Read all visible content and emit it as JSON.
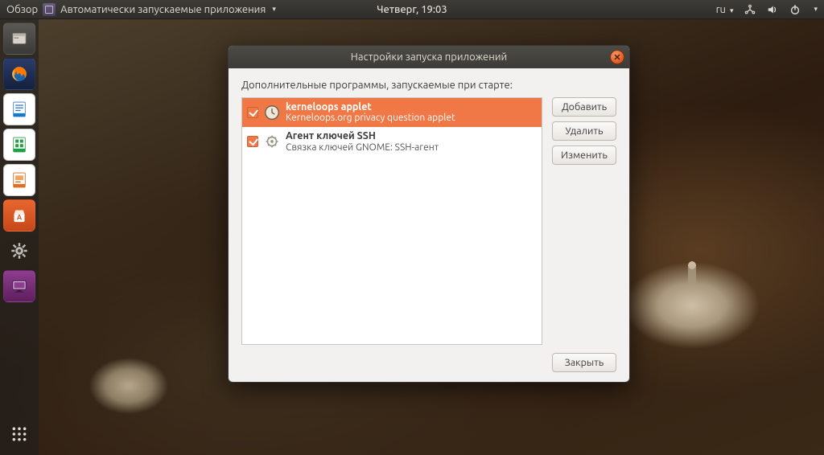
{
  "topbar": {
    "activities": "Обзор",
    "app_title": "Автоматически запускаемые приложения",
    "clock": "Четверг, 19:03",
    "lang": "ru"
  },
  "launcher": {
    "items": [
      {
        "name": "files-app",
        "icon": "files"
      },
      {
        "name": "firefox-app",
        "icon": "firefox"
      },
      {
        "name": "writer-app",
        "icon": "writer"
      },
      {
        "name": "calc-app",
        "icon": "calc"
      },
      {
        "name": "impress-app",
        "icon": "impress"
      },
      {
        "name": "software-app",
        "icon": "software"
      },
      {
        "name": "settings-app",
        "icon": "gear"
      },
      {
        "name": "displays-app",
        "icon": "display"
      }
    ]
  },
  "dialog": {
    "title": "Настройки запуска приложений",
    "description": "Дополнительные программы, запускаемые при старте:",
    "items": [
      {
        "checked": true,
        "selected": true,
        "icon": "clock",
        "name": "kerneloops applet",
        "subtitle": "Kerneloops.org privacy question applet"
      },
      {
        "checked": true,
        "selected": false,
        "icon": "keys",
        "name": "Агент ключей SSH",
        "subtitle": "Связка ключей GNOME: SSH-агент"
      }
    ],
    "buttons": {
      "add": "Добавить",
      "remove": "Удалить",
      "edit": "Изменить",
      "close": "Закрыть"
    }
  },
  "colors": {
    "accent": "#f07746"
  }
}
